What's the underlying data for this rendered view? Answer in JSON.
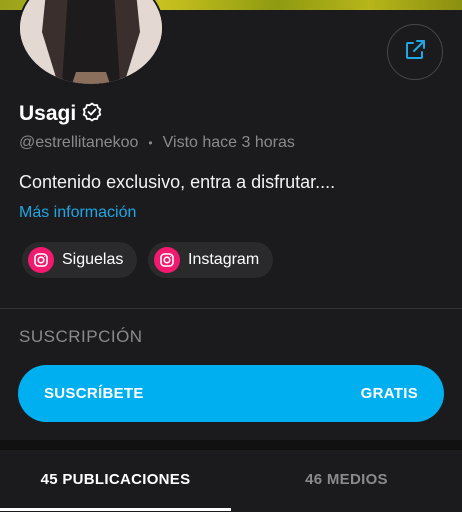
{
  "profile": {
    "name": "Usagi",
    "handle": "@estrellitanekoo",
    "separator": "•",
    "last_seen": "Visto  hace 3 horas",
    "bio": "Contenido exclusivo, entra a disfrutar....",
    "more_info": "Más información"
  },
  "links": [
    {
      "label": "Siguelas",
      "icon": "instagram-icon"
    },
    {
      "label": "Instagram",
      "icon": "instagram-icon"
    }
  ],
  "subscription": {
    "section_title": "SUSCRIPCIÓN",
    "button_label": "SUSCRÍBETE",
    "price_label": "GRATIS"
  },
  "tabs": [
    {
      "label": "45 PUBLICACIONES",
      "active": true
    },
    {
      "label": "46 MEDIOS",
      "active": false
    }
  ],
  "colors": {
    "background": "#1b1b1d",
    "accent": "#00aff0",
    "link": "#1ea7e4",
    "instagram": "#f21a6e"
  }
}
